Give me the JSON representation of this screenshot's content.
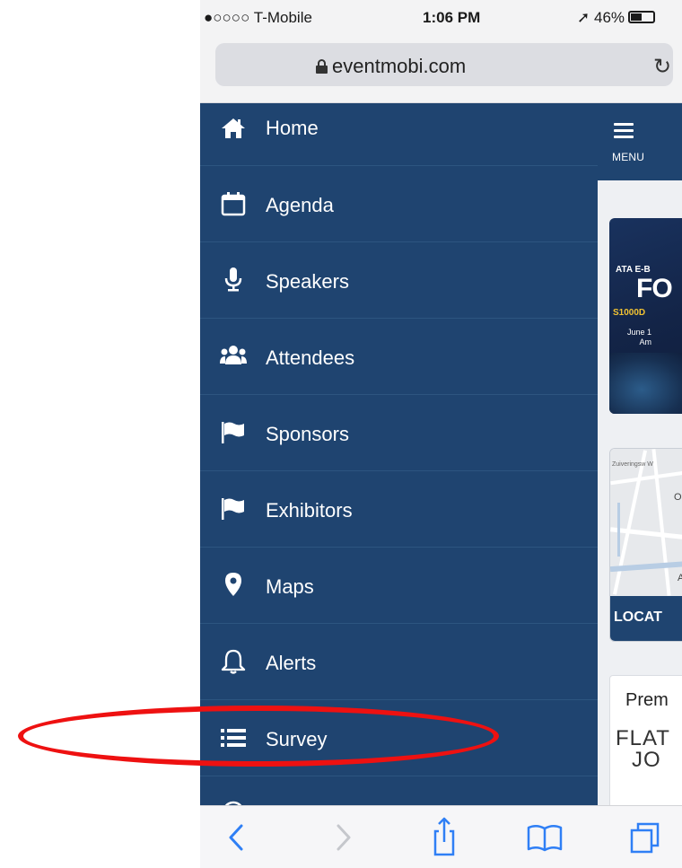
{
  "status_bar": {
    "carrier": "●○○○○ T-Mobile",
    "time": "1:06 PM",
    "battery": "46%"
  },
  "browser": {
    "url": "eventmobi.com"
  },
  "side_menu": {
    "items": [
      {
        "label": "Home",
        "icon": "home-icon"
      },
      {
        "label": "Agenda",
        "icon": "calendar-icon"
      },
      {
        "label": "Speakers",
        "icon": "microphone-icon"
      },
      {
        "label": "Attendees",
        "icon": "people-icon"
      },
      {
        "label": "Sponsors",
        "icon": "flag-icon"
      },
      {
        "label": "Exhibitors",
        "icon": "flag-icon"
      },
      {
        "label": "Maps",
        "icon": "map-marker-icon"
      },
      {
        "label": "Alerts",
        "icon": "bell-icon"
      },
      {
        "label": "Survey",
        "icon": "list-icon"
      }
    ]
  },
  "content": {
    "menu_label": "MENU",
    "banner": {
      "line1": "ATA E-B",
      "big": "FO",
      "gold": "S1000D",
      "date_line1": "June 1",
      "date_line2": "Am"
    },
    "map": {
      "label_text_1": "Zuiveringsw W",
      "label_text_2": "O",
      "label_text_3": "A",
      "location_label": "LOCAT"
    },
    "premium": {
      "title": "Prem",
      "line1": "FLAT",
      "line2": "JO"
    }
  },
  "colors": {
    "menu_bg": "#1f4470",
    "highlight": "#ee1111"
  }
}
